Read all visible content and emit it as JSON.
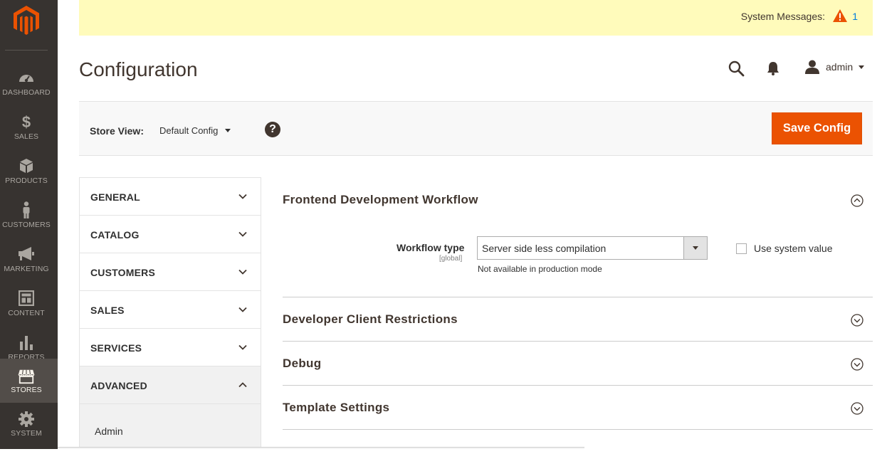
{
  "app": {
    "page_title": "Configuration"
  },
  "admin_menu": {
    "items": [
      {
        "label": "DASHBOARD",
        "icon": "dashboard-icon"
      },
      {
        "label": "SALES",
        "icon": "dollar-icon"
      },
      {
        "label": "PRODUCTS",
        "icon": "box-icon"
      },
      {
        "label": "CUSTOMERS",
        "icon": "person-icon"
      },
      {
        "label": "MARKETING",
        "icon": "megaphone-icon"
      },
      {
        "label": "CONTENT",
        "icon": "layout-icon"
      },
      {
        "label": "REPORTS",
        "icon": "bar-chart-icon"
      },
      {
        "label": "STORES",
        "icon": "store-icon"
      },
      {
        "label": "SYSTEM",
        "icon": "gear-icon"
      }
    ],
    "active": "STORES"
  },
  "system_messages": {
    "label": "System Messages:",
    "count": "1"
  },
  "header": {
    "user_name": "admin"
  },
  "toolbar": {
    "store_view_label": "Store View:",
    "store_view_value": "Default Config",
    "help_symbol": "?",
    "save_label": "Save Config"
  },
  "tabs": {
    "items": [
      {
        "label": "GENERAL",
        "open": false
      },
      {
        "label": "CATALOG",
        "open": false
      },
      {
        "label": "CUSTOMERS",
        "open": false
      },
      {
        "label": "SALES",
        "open": false
      },
      {
        "label": "SERVICES",
        "open": false
      },
      {
        "label": "ADVANCED",
        "open": true
      }
    ],
    "advanced_sub": [
      "Admin"
    ]
  },
  "sections": [
    {
      "title": "Frontend Development Workflow",
      "expanded": true
    },
    {
      "title": "Developer Client Restrictions",
      "expanded": false
    },
    {
      "title": "Debug",
      "expanded": false
    },
    {
      "title": "Template Settings",
      "expanded": false
    }
  ],
  "workflow_field": {
    "label": "Workflow type",
    "scope": "[global]",
    "value": "Server side less compilation",
    "note": "Not available in production mode",
    "use_system_value_label": "Use system value",
    "use_system_value_checked": false
  },
  "colors": {
    "menu_bg": "#373330",
    "accent": "#eb5202",
    "message_bar": "#fffbbb",
    "link": "#007bdb"
  }
}
